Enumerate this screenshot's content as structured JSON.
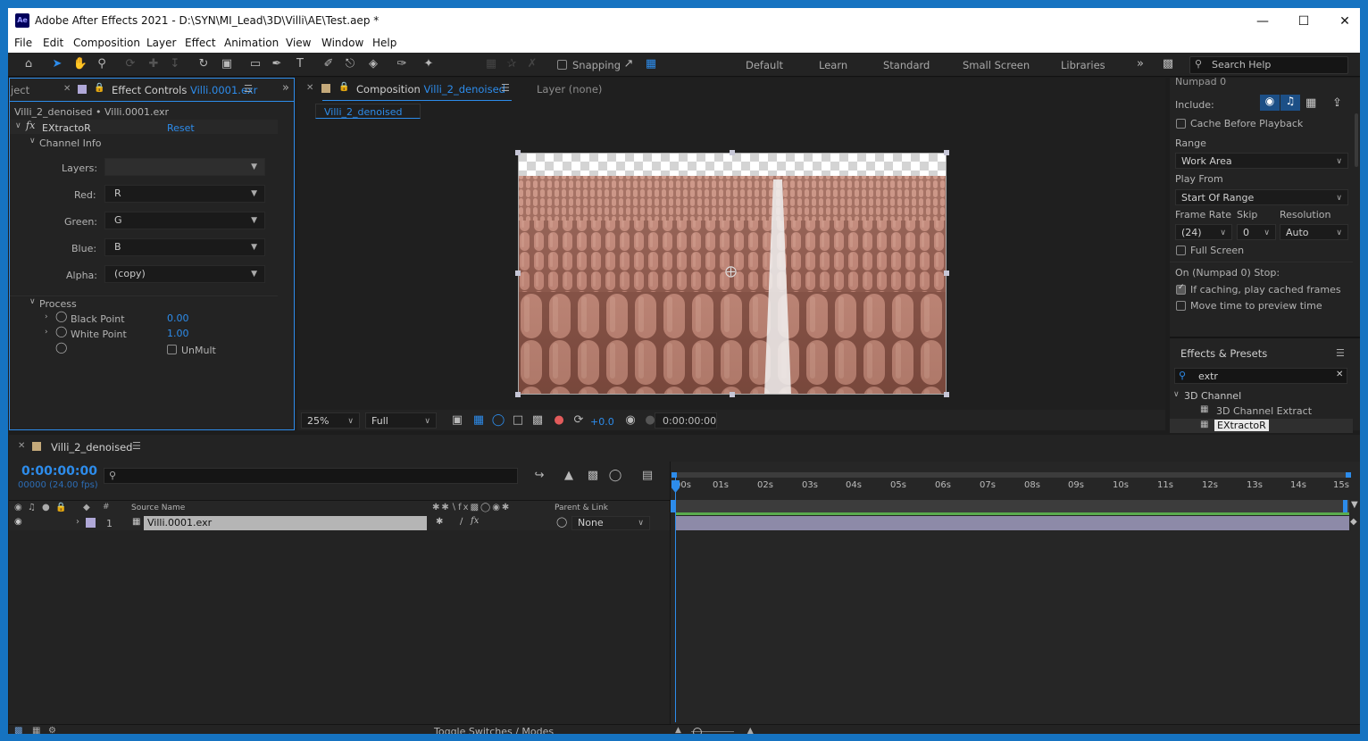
{
  "window": {
    "title": "Adobe After Effects 2021 - D:\\SYN\\MI_Lead\\3D\\Villi\\AE\\Test.aep *",
    "app_icon": "Ae"
  },
  "menu": [
    "File",
    "Edit",
    "Composition",
    "Layer",
    "Effect",
    "Animation",
    "View",
    "Window",
    "Help"
  ],
  "toolbar": {
    "snapping": "Snapping",
    "search_placeholder": "Search Help",
    "workspaces": [
      "Default",
      "Learn",
      "Standard",
      "Small Screen",
      "Libraries"
    ]
  },
  "effect_controls": {
    "prev_tab": "ject",
    "tab_label": "Effect Controls",
    "tab_file": "Villi.0001.exr",
    "path": "Villi_2_denoised • Villi.0001.exr",
    "effect_name": "EXtractoR",
    "reset": "Reset",
    "channel_info": "Channel Info",
    "layers_label": "Layers:",
    "red_label": "Red:",
    "red_value": "R",
    "green_label": "Green:",
    "green_value": "G",
    "blue_label": "Blue:",
    "blue_value": "B",
    "alpha_label": "Alpha:",
    "alpha_value": "(copy)",
    "process": "Process",
    "black_point_label": "Black Point",
    "black_point_value": "0.00",
    "white_point_label": "White Point",
    "white_point_value": "1.00",
    "unmult": "UnMult"
  },
  "composition": {
    "tab_label": "Composition",
    "tab_name": "Villi_2_denoised",
    "layer_tab": "Layer (none)",
    "breadcrumb": "Villi_2_denoised",
    "zoom": "25%",
    "resolution": "Full",
    "exposure": "+0.0",
    "timecode": "0:00:00:00"
  },
  "preview": {
    "numpad": "Numpad 0",
    "include": "Include:",
    "cache": "Cache Before Playback",
    "range_label": "Range",
    "range_value": "Work Area",
    "play_from_label": "Play From",
    "play_from_value": "Start Of Range",
    "frame_rate_label": "Frame Rate",
    "skip_label": "Skip",
    "resolution_label": "Resolution",
    "frame_rate_value": "(24)",
    "skip_value": "0",
    "resolution_value": "Auto",
    "full_screen": "Full Screen",
    "stop_label": "On (Numpad 0) Stop:",
    "if_caching": "If caching, play cached frames",
    "move_time": "Move time to preview time"
  },
  "effects_presets": {
    "title": "Effects & Presets",
    "search_value": "extr",
    "category": "3D Channel",
    "items": [
      "3D Channel Extract",
      "EXtractoR"
    ]
  },
  "timeline": {
    "comp_name": "Villi_2_denoised",
    "timecode": "0:00:00:00",
    "frame_info": "00000 (24.00 fps)",
    "search_placeholder": "",
    "col_source": "Source Name",
    "col_parent": "Parent & Link",
    "hash": "#",
    "layer_num": "1",
    "layer_name": "Villi.0001.exr",
    "parent_value": "None",
    "ticks": [
      "00s",
      "01s",
      "02s",
      "03s",
      "04s",
      "05s",
      "06s",
      "07s",
      "08s",
      "09s",
      "10s",
      "11s",
      "12s",
      "13s",
      "14s",
      "15s"
    ],
    "toggle": "Toggle Switches / Modes"
  },
  "colors": {
    "accent": "#2d8ceb",
    "frame": "#1673c1",
    "panel": "#232323",
    "layer_bar": "#8d8aa8",
    "work_area": "#5aab4e"
  }
}
